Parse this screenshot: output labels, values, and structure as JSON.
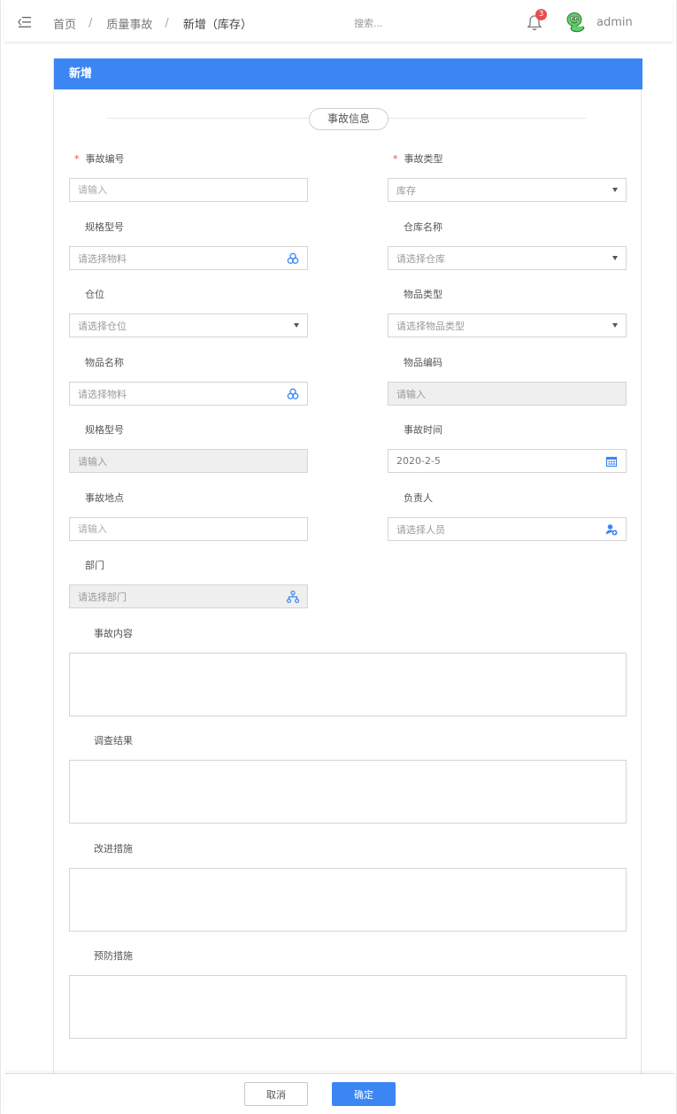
{
  "header": {
    "breadcrumb": [
      "首页",
      "质量事故",
      "新增（库存）"
    ],
    "breadcrumb_sep": "/",
    "search_placeholder": "搜索...",
    "notification_count": "3",
    "username": "admin"
  },
  "card": {
    "title": "新增",
    "section_title": "事故信息"
  },
  "form": {
    "accident_no": {
      "label": "事故编号",
      "required": "*",
      "placeholder": "请输入"
    },
    "accident_type": {
      "label": "事故类型",
      "required": "*",
      "value": "库存"
    },
    "spec_model": {
      "label": "规格型号",
      "placeholder": "请选择物料"
    },
    "warehouse_name": {
      "label": "仓库名称",
      "placeholder": "请选择仓库"
    },
    "location": {
      "label": "仓位",
      "placeholder": "请选择仓位"
    },
    "item_type": {
      "label": "物品类型",
      "placeholder": "请选择物品类型"
    },
    "item_name": {
      "label": "物品名称",
      "placeholder": "请选择物料"
    },
    "item_code": {
      "label": "物品编码",
      "placeholder": "请输入"
    },
    "spec_model_2": {
      "label": "规格型号",
      "placeholder": "请输入"
    },
    "accident_time": {
      "label": "事故时间",
      "value": "2020-2-5"
    },
    "accident_place": {
      "label": "事故地点",
      "placeholder": "请输入"
    },
    "responsible": {
      "label": "负责人",
      "placeholder": "请选择人员"
    },
    "department": {
      "label": "部门",
      "placeholder": "请选择部门"
    },
    "content": {
      "label": "事故内容"
    },
    "investigation": {
      "label": "调查结果"
    },
    "improvement": {
      "label": "改进措施"
    },
    "prevention": {
      "label": "预防措施"
    }
  },
  "footer": {
    "cancel": "取消",
    "confirm": "确定"
  },
  "colors": {
    "primary": "#3c86f3",
    "badge": "#e84c4c"
  },
  "icons": {
    "menu": "menu-fold-icon",
    "bell": "bell-icon",
    "material": "cubes-icon",
    "calendar": "calendar-icon",
    "person": "user-add-icon",
    "department": "org-tree-icon"
  }
}
